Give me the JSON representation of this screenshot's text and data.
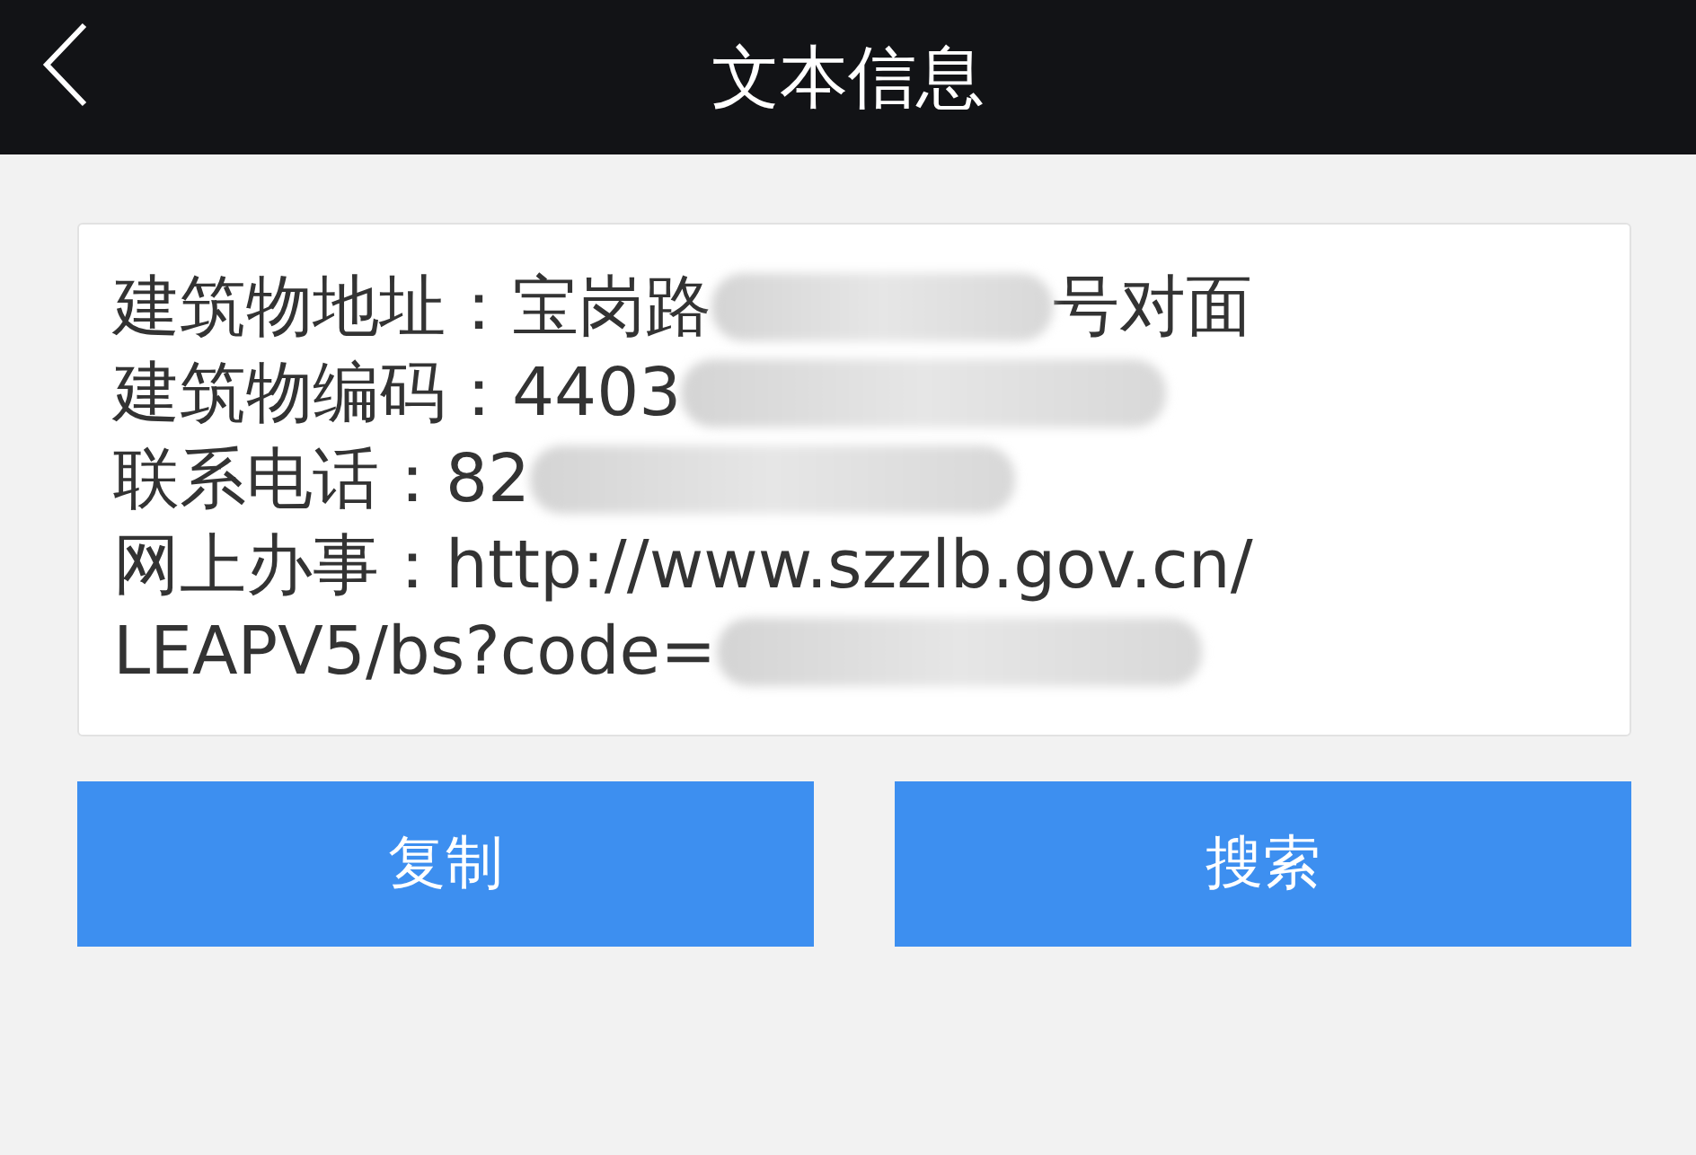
{
  "header": {
    "title": "文本信息"
  },
  "message": {
    "lines": [
      {
        "parts": [
          {
            "kind": "text",
            "text": "建筑物地址：宝岗路"
          },
          {
            "kind": "blur"
          },
          {
            "kind": "text",
            "text": "号对面"
          }
        ]
      },
      {
        "parts": [
          {
            "kind": "text",
            "text": "建筑物编码：4403"
          },
          {
            "kind": "blur"
          }
        ]
      },
      {
        "parts": [
          {
            "kind": "text",
            "text": "联系电话：82"
          },
          {
            "kind": "blur"
          }
        ]
      },
      {
        "parts": [
          {
            "kind": "text",
            "text": "网上办事：http://www.szzlb.gov.cn/"
          }
        ]
      },
      {
        "parts": [
          {
            "kind": "text",
            "text": "LEAPV5/bs?code="
          },
          {
            "kind": "blur"
          }
        ]
      }
    ]
  },
  "buttons": [
    "复制",
    "搜索"
  ]
}
